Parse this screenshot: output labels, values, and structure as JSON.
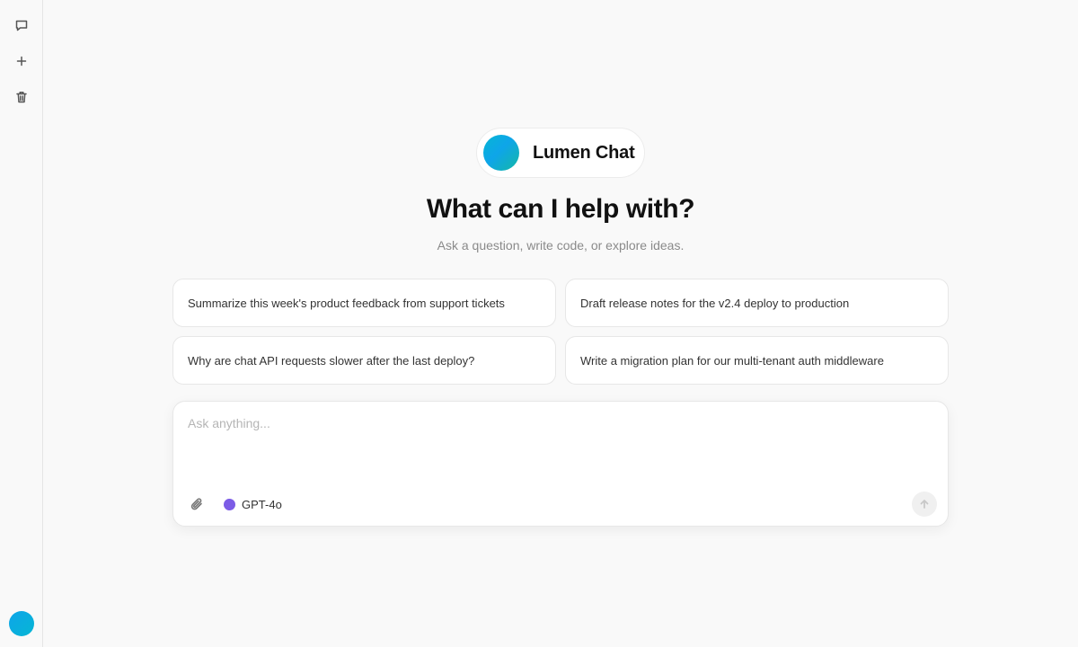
{
  "sidebar": {
    "icons": [
      "chat-bubble-icon",
      "plus-icon",
      "trash-icon"
    ],
    "avatar_color": "#06b6d4"
  },
  "brand": {
    "name": "Lumen Chat",
    "logo_color": "#06b6d4"
  },
  "hero": {
    "title": "What can I help with?",
    "subtitle": "Ask a question, write code, or explore ideas."
  },
  "suggestions": [
    "Summarize this week's product feedback from support tickets",
    "Draft release notes for the v2.4 deploy to production",
    "Why are chat API requests slower after the last deploy?",
    "Write a migration plan for our multi-tenant auth middleware"
  ],
  "composer": {
    "placeholder": "Ask anything...",
    "value": "",
    "model": {
      "label": "GPT-4o",
      "color": "#7c5ce6"
    },
    "icons": [
      "paperclip-icon",
      "arrow-up-icon"
    ]
  }
}
